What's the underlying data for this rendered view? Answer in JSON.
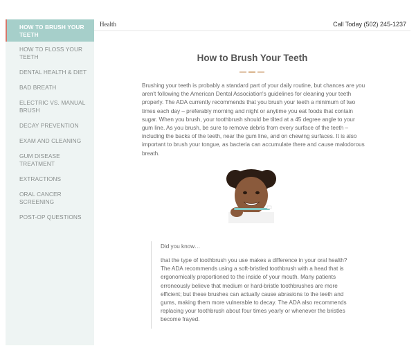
{
  "sidebar": {
    "items": [
      {
        "label": "HOW TO BRUSH YOUR TEETH"
      },
      {
        "label": "HOW TO FLOSS YOUR TEETH"
      },
      {
        "label": "DENTAL HEALTH & DIET"
      },
      {
        "label": "BAD BREATH"
      },
      {
        "label": "ELECTRIC VS. MANUAL BRUSH"
      },
      {
        "label": "DECAY PREVENTION"
      },
      {
        "label": "EXAM AND CLEANING"
      },
      {
        "label": "GUM DISEASE TREATMENT"
      },
      {
        "label": "EXTRACTIONS"
      },
      {
        "label": "ORAL CANCER SCREENING"
      },
      {
        "label": "POST-OP QUESTIONS"
      }
    ]
  },
  "header": {
    "breadcrumb": "Health",
    "phone": "Call Today (502) 245-1237"
  },
  "main": {
    "title": "How to Brush Your Teeth",
    "intro": "Brushing your teeth is probably a standard part of your daily routine, but chances are you aren't following the American Dental Association's guidelines for cleaning your teeth properly. The ADA currently recommends that you brush your teeth a minimum of two times each day – preferably morning and night or anytime you eat foods that contain sugar. When you brush, your toothbrush should be tilted at a 45 degree angle to your gum line. As you brush, be sure to remove debris from every surface of the teeth – including the backs of the teeth, near the gum line, and on chewing surfaces. It is also important to brush your tongue, as bacteria can accumulate there and cause malodorous breath.",
    "callout": {
      "title": "Did you know…",
      "body": "that the type of toothbrush you use makes a difference in your oral health? The ADA recommends using a soft-bristled toothbrush with a head that is ergonomically proportioned to the inside of your mouth. Many patients erroneously believe that medium or hard-bristle toothbrushes are more efficient; but these brushes can actually cause abrasions to the teeth and gums, making them more vulnerable to decay. The ADA also recommends replacing your toothbrush about four times yearly or whenever the bristles become frayed."
    }
  },
  "colors": {
    "sidebar_bg": "#eef4f3",
    "active_bg": "#a6cfca",
    "accent": "#d7776a"
  }
}
